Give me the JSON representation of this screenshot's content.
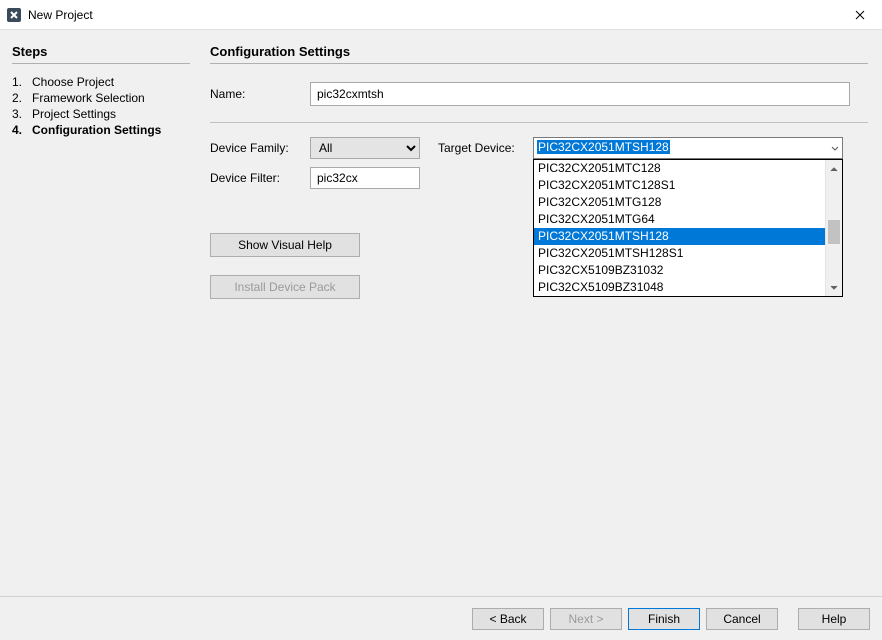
{
  "window": {
    "title": "New Project"
  },
  "sidebar": {
    "heading": "Steps",
    "steps": [
      {
        "num": "1.",
        "label": "Choose Project",
        "current": false
      },
      {
        "num": "2.",
        "label": "Framework Selection",
        "current": false
      },
      {
        "num": "3.",
        "label": "Project Settings",
        "current": false
      },
      {
        "num": "4.",
        "label": "Configuration Settings",
        "current": true
      }
    ]
  },
  "main": {
    "heading": "Configuration Settings",
    "name_label": "Name:",
    "name_value": "pic32cxmtsh",
    "device_family_label": "Device Family:",
    "device_family_value": "All",
    "target_device_label": "Target Device:",
    "target_device_value": "PIC32CX2051MTSH128",
    "device_filter_label": "Device Filter:",
    "device_filter_value": "pic32cx",
    "show_visual_help": "Show Visual Help",
    "install_device_pack": "Install Device Pack",
    "dropdown_options": [
      "PIC32CX2051MTC128",
      "PIC32CX2051MTC128S1",
      "PIC32CX2051MTG128",
      "PIC32CX2051MTG64",
      "PIC32CX2051MTSH128",
      "PIC32CX2051MTSH128S1",
      "PIC32CX5109BZ31032",
      "PIC32CX5109BZ31048"
    ],
    "dropdown_selected_index": 4
  },
  "footer": {
    "back": "< Back",
    "next": "Next >",
    "finish": "Finish",
    "cancel": "Cancel",
    "help": "Help"
  }
}
